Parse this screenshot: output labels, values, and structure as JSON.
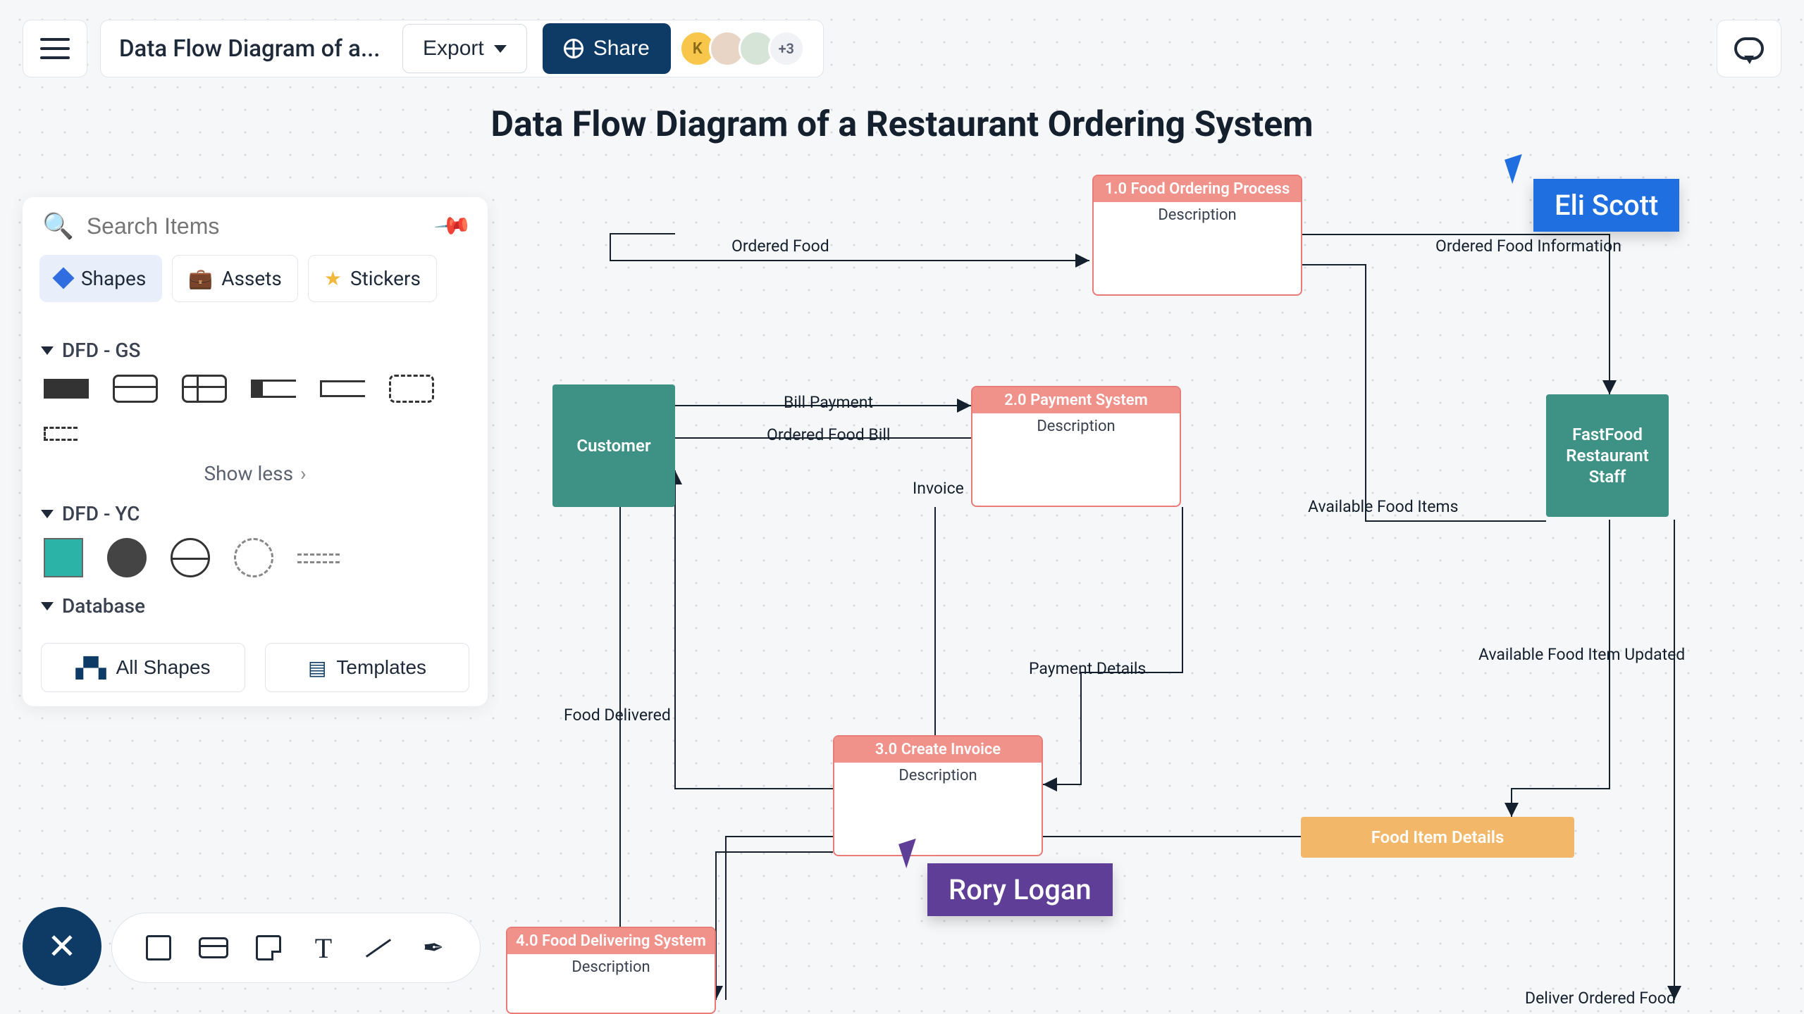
{
  "header": {
    "document_title": "Data Flow Diagram of a...",
    "export_label": "Export",
    "share_label": "Share",
    "avatars": {
      "k": "K",
      "more": "+3"
    }
  },
  "search": {
    "placeholder": "Search Items"
  },
  "tabs": {
    "shapes": "Shapes",
    "assets": "Assets",
    "stickers": "Stickers"
  },
  "sections": {
    "dfd_gs": "DFD - GS",
    "show_less": "Show less",
    "dfd_yc": "DFD - YC",
    "database": "Database"
  },
  "panel_buttons": {
    "all_shapes": "All Shapes",
    "templates": "Templates"
  },
  "diagram": {
    "title": "Data Flow Diagram of a Restaurant Ordering System",
    "nodes": {
      "customer": "Customer",
      "staff_l1": "FastFood",
      "staff_l2": "Restaurant",
      "staff_l3": "Staff",
      "p1_title": "1.0  Food Ordering Process",
      "p1_desc": "Description",
      "p2_title": "2.0 Payment System",
      "p2_desc": "Description",
      "p3_title": "3.0 Create Invoice",
      "p3_desc": "Description",
      "p4_title": "4.0 Food Delivering System",
      "p4_desc": "Description",
      "food_item_details": "Food Item Details"
    },
    "labels": {
      "ordered_food": "Ordered Food",
      "ordered_food_info": "Ordered Food Information",
      "bill_payment": "Bill Payment",
      "ordered_food_bill": "Ordered Food Bill",
      "invoice": "Invoice",
      "available_food_items": "Available Food Items",
      "payment_details": "Payment Details",
      "food_delivered": "Food Delivered",
      "available_food_item_updated": "Available Food Item Updated",
      "deliver_ordered_food": "Deliver Ordered Food"
    }
  },
  "cursors": {
    "eli": "Eli Scott",
    "rory": "Rory Logan"
  }
}
